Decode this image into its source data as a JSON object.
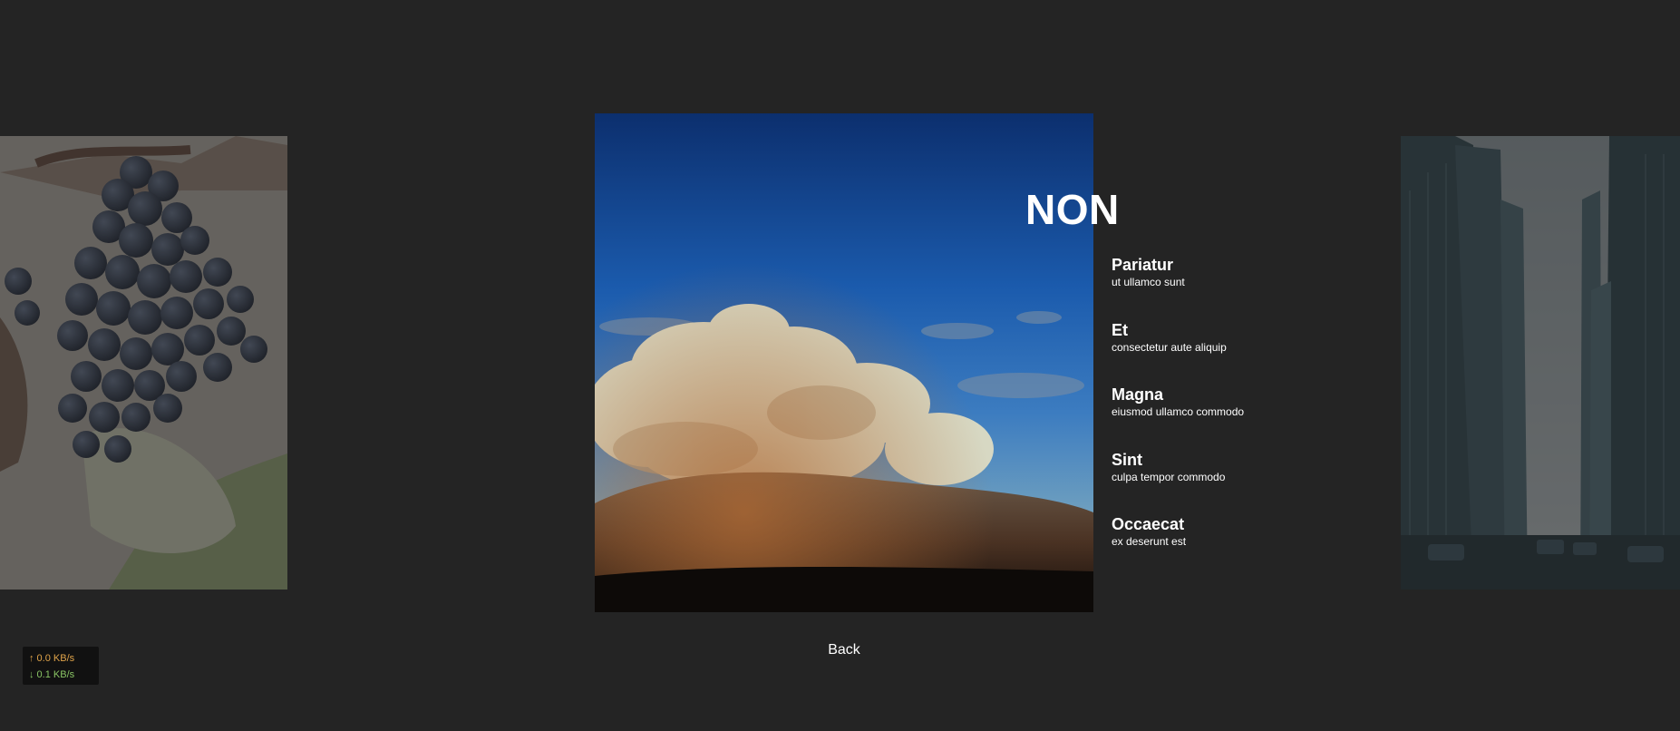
{
  "main": {
    "title": "NON",
    "items": [
      {
        "heading": "Pariatur",
        "sub": "ut ullamco sunt"
      },
      {
        "heading": "Et",
        "sub": "consectetur aute aliquip"
      },
      {
        "heading": "Magna",
        "sub": "eiusmod ullamco commodo"
      },
      {
        "heading": "Sint",
        "sub": "culpa tempor commodo"
      },
      {
        "heading": "Occaecat",
        "sub": "ex deserunt est"
      }
    ],
    "back_label": "Back"
  },
  "images": {
    "left": "grapes-image",
    "center": "clouds-image",
    "right": "city-street-image"
  },
  "network": {
    "upload": "↑ 0.0 KB/s",
    "download": "↓ 0.1 KB/s"
  },
  "colors": {
    "background": "#242424",
    "upload": "#e0a44a",
    "download": "#8ac565"
  }
}
